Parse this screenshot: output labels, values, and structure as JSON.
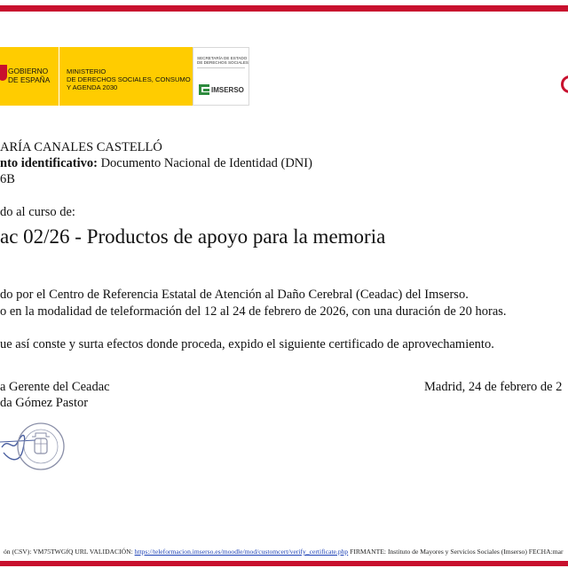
{
  "header": {
    "gob_line1": "GOBIERNO",
    "gob_line2": "DE ESPAÑA",
    "ministry_line1": "MINISTERIO",
    "ministry_line2": "DE DERECHOS SOCIALES, CONSUMO",
    "ministry_line3": "Y AGENDA 2030",
    "secretaria_line1": "SECRETARÍA DE ESTADO",
    "secretaria_line2": "DE DERECHOS SOCIALES",
    "imserso": "IMSERSO"
  },
  "recipient": {
    "name": "ARÍA CANALES CASTELLÓ",
    "doc_label": "nto identificativo:",
    "doc_value": " Documento Nacional de Identidad (DNI)",
    "doc_number": "6B"
  },
  "course": {
    "intro": "do al curso de:",
    "title": "ac 02/26 - Productos de apoyo para la memoria"
  },
  "body": {
    "line1": "do por el Centro de Referencia Estatal de Atención al Daño Cerebral (Ceadac) del Imserso.",
    "line2": "o en la modalidad de teleformación del 12 al 24 de febrero de 2026, con una duración de 20 horas.",
    "line3": "ue así conste y surta efectos donde proceda, expido el siguiente certificado de aprovechamiento."
  },
  "signature": {
    "role": "a Gerente del Ceadac",
    "name": "da Gómez Pastor",
    "place_date": "Madrid, 24 de febrero de 2"
  },
  "footer": {
    "csv_label": "ón (CSV):  ",
    "csv_value": "VM75TWGfQ",
    "url_label": "    URL VALIDACIÓN: ",
    "url": "https://teleformacion.imserso.es/moodle/mod/customcert/verify_certificate.php",
    "firmante": "  FIRMANTE: Instituto de Mayores y Servicios Sociales (Imserso)    FECHA:mar"
  },
  "colors": {
    "band_red": "#c8102e",
    "gov_yellow": "#ffcc00",
    "imserso_green": "#2e8b3e",
    "link_blue": "#1a3fb4"
  }
}
